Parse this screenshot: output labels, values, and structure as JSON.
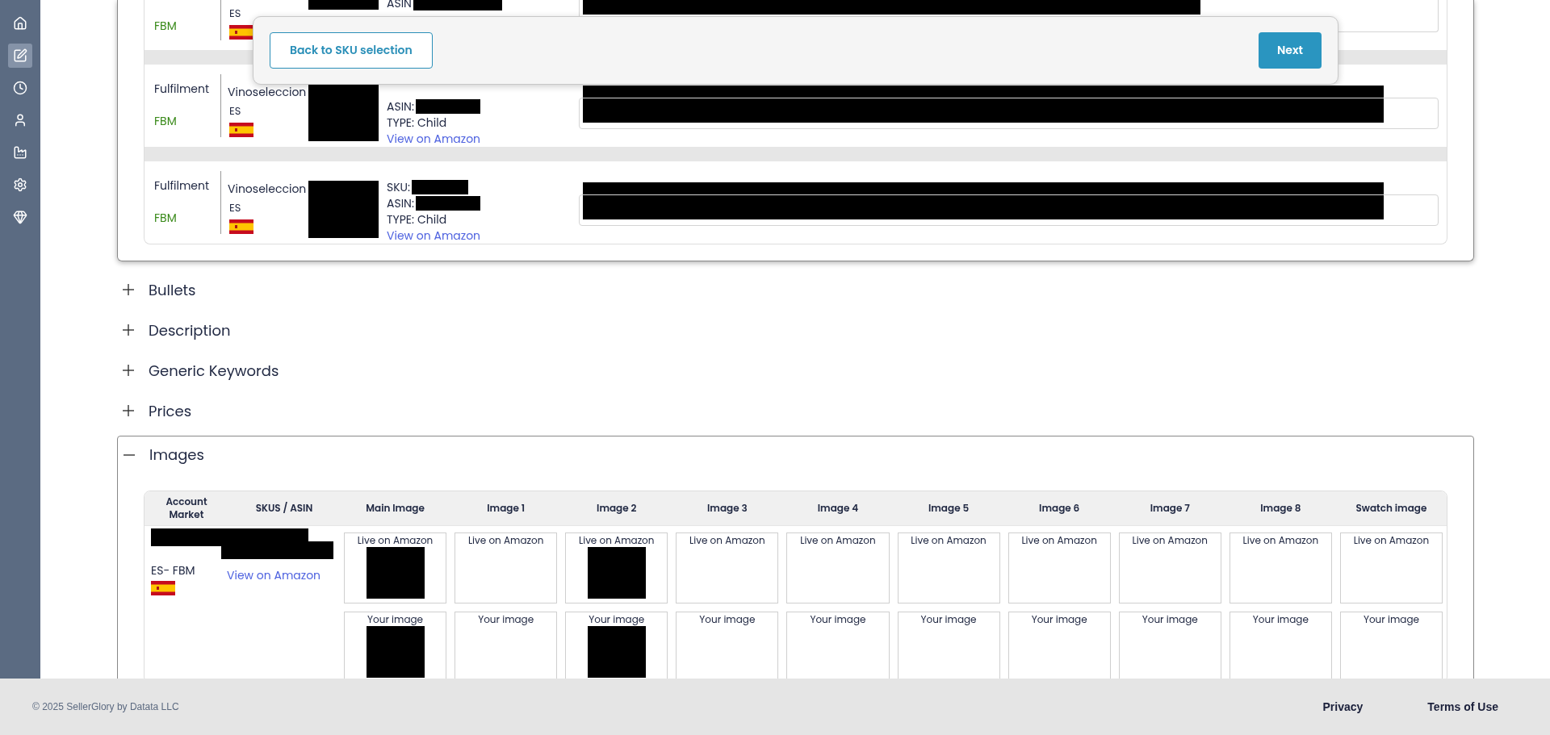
{
  "sidebar": {
    "items": [
      {
        "kind": "home",
        "selected": false
      },
      {
        "kind": "edit",
        "selected": true
      },
      {
        "kind": "clock",
        "selected": false
      },
      {
        "kind": "user",
        "selected": false
      },
      {
        "kind": "factory",
        "selected": false
      },
      {
        "kind": "settings",
        "selected": false
      },
      {
        "kind": "gem",
        "selected": false
      }
    ]
  },
  "listing_rows": [
    {
      "kind": "partial",
      "channel": "FBM",
      "market": "ES",
      "asin_label": "ASIN"
    },
    {
      "kind": "full",
      "fulfilment_label": "Fulfilment",
      "channel": "FBM",
      "account": "Vinoseleccion",
      "market": "ES",
      "asin_label": "ASIN:",
      "type_label": "TYPE:",
      "type_value": "Child",
      "link": "View on Amazon"
    },
    {
      "kind": "full",
      "fulfilment_label": "Fulfilment",
      "channel": "FBM",
      "account": "Vinoseleccion",
      "market": "ES",
      "sku_label": "SKU:",
      "asin_label": "ASIN:",
      "type_label": "TYPE:",
      "type_value": "Child",
      "link": "View on Amazon"
    }
  ],
  "overlay": {
    "back_button": "Back to SKU selection",
    "next_button": "Next"
  },
  "sections": [
    {
      "title": "Bullets",
      "expanded": false
    },
    {
      "title": "Description",
      "expanded": false
    },
    {
      "title": "Generic Keywords",
      "expanded": false
    },
    {
      "title": "Prices",
      "expanded": false
    },
    {
      "title": "Images",
      "expanded": true
    }
  ],
  "images_table": {
    "columns": [
      "Account Market",
      "SKUS / ASIN",
      "Main Image",
      "Image 1",
      "Image 2",
      "Image 3",
      "Image 4",
      "Image 5",
      "Image 6",
      "Image 7",
      "Image 8",
      "Swatch image"
    ],
    "rows": [
      {
        "market": "ES- FBM",
        "link": "View on Amazon",
        "image_slots": [
          {
            "live_label": "Live on Amazon",
            "live_redacted": true,
            "your_label": "Your image",
            "your_redacted": true
          },
          {
            "live_label": "Live on Amazon",
            "live_redacted": false,
            "your_label": "Your image",
            "your_redacted": false
          },
          {
            "live_label": "Live on Amazon",
            "live_redacted": true,
            "your_label": "Your image",
            "your_redacted": true
          },
          {
            "live_label": "Live on Amazon",
            "live_redacted": false,
            "your_label": "Your image",
            "your_redacted": false
          },
          {
            "live_label": "Live on Amazon",
            "live_redacted": false,
            "your_label": "Your image",
            "your_redacted": false
          },
          {
            "live_label": "Live on Amazon",
            "live_redacted": false,
            "your_label": "Your image",
            "your_redacted": false
          },
          {
            "live_label": "Live on Amazon",
            "live_redacted": false,
            "your_label": "Your image",
            "your_redacted": false
          },
          {
            "live_label": "Live on Amazon",
            "live_redacted": false,
            "your_label": "Your image",
            "your_redacted": false
          },
          {
            "live_label": "Live on Amazon",
            "live_redacted": false,
            "your_label": "Your image",
            "your_redacted": false
          },
          {
            "live_label": "Live on Amazon",
            "live_redacted": false,
            "your_label": "Your image",
            "your_redacted": false
          }
        ]
      }
    ]
  },
  "footer": {
    "copyright": "© 2025 SellerGlory by Datata LLC",
    "links": [
      "Privacy",
      "Terms of Use"
    ]
  }
}
